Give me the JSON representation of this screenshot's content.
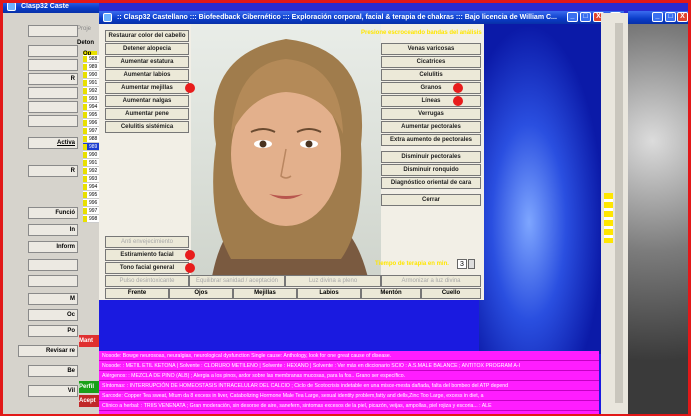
{
  "back_window": {
    "title": "Clasp32 Caste"
  },
  "left_app": {
    "buttons": [
      "R",
      "Activa",
      "R",
      "Funció",
      "In",
      "Inform",
      "M",
      "Oc",
      "Po",
      "Revisar re",
      "Be",
      "Vil"
    ],
    "labels": {
      "proje": "Proje",
      "deton": "Deton",
      "op": "Op",
      "mant": "Mant",
      "perfil": "Perfil",
      "acep": "Acept"
    },
    "numbers": [
      "988",
      "989",
      "990",
      "991",
      "992",
      "993",
      "994",
      "995",
      "996",
      "997",
      "988",
      "989",
      "990",
      "991",
      "992",
      "993",
      "994",
      "995",
      "996",
      "997",
      "998"
    ]
  },
  "window": {
    "title": ":: Clasp32 Castellano ::: Biofeedback Cibernético ::: Exploración corporal, facial & terapia de chakras ::: Bajo licencia de William C...",
    "controls": [
      "_",
      "□",
      "X"
    ]
  },
  "left_buttons": [
    "Restaurar color del cabello",
    "Detener alopecia",
    "Aumentar estatura",
    "Aumentar labios",
    "Aumentar mejillas",
    "Aumentar nalgas",
    "Aumentar pene",
    "Celulitis sistémica"
  ],
  "left_lower_buttons": [
    "Anti envejecimiento",
    "Estiramiento facial",
    "Tono facial general"
  ],
  "right_buttons": [
    "Venas varicosas",
    "Cicatrices",
    "Celulitis",
    "Granos",
    "Líneas",
    "Verrugas",
    "Aumentar pectorales",
    "Extra aumento de pectorales",
    "Disminuir pectorales",
    "Disminuir ronquido",
    "Diagnóstico oriental de cara",
    "Cerrar"
  ],
  "top_note": "Presione escroceando bandas del análisis",
  "row_disabled": [
    "Pulso desintoxicante",
    "Equilibrar sanidad / aceptación",
    "Luz divina a pleno",
    "Armonizar a luz divina"
  ],
  "tabs": [
    "Frente",
    "Ojos",
    "Mejillas",
    "Labios",
    "Mentón",
    "Cuello"
  ],
  "therapy": {
    "label": "Tiempo de terapia en min.",
    "value": "3"
  },
  "info_lines": [
    "Nosode: Bowge neurosoas, neuralgias, neurological dysfunction Single cause: Anthology, look for one great cause of disease.",
    "Nosode: : METIL ETIL KETONA | Solvente : CLORURO METILENO | Solvente : HEXANO | Solvente : Ver más en diccionario SCIO : A.S.MALE BALANCE ; ANTITOX PROGRAM A-I",
    "Alérgenos: : MEZCLA DE PINO (ALB) ; Alergia a los pinos, ardor sobre las membranas mucosas, para la fos.. Grano ser específico.",
    "Síntomas: : INTERRUPCIÓN DE HOMEOSTASIS INTRACELULAR DEL CALCIO ; Ciclo de Scotocrisis indetable en una misce-mesta dañada, falta del bombeo del ATP depend",
    "Sarcode: Copper Tea sweat, Mtum da 8 excess in liver, Catabolizing Hormone Male Tea Large, sexual identity problem,fatty and dells,Zinc Too Large, excess in diet, a",
    "Clínico a herbal: : TRIIS VENENATA ; Gran moderación, sin desorse de aire, sanefern, sintomas excesos de la piel, picazón, veijas, ampollas, piel rojiza y escoria... : ALE"
  ],
  "colors": {
    "title_blue": "#0a3cc8",
    "info_magenta": "#ff1dff",
    "red_marker": "#e81c1c",
    "yellow_text": "#ffe600"
  }
}
